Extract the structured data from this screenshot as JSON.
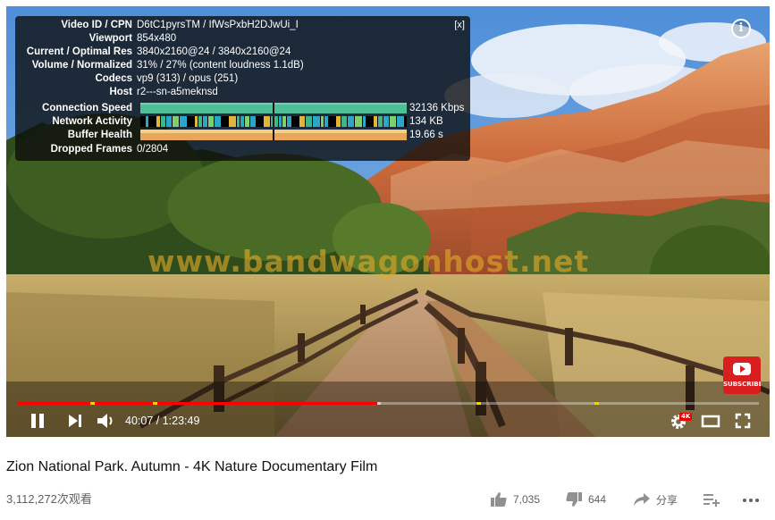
{
  "stats_overlay": {
    "close": "[x]",
    "rows": [
      {
        "label": "Video ID / CPN",
        "value": "D6tC1pyrsTM / IfWsPxbH2DJwUi_I"
      },
      {
        "label": "Viewport",
        "value": "854x480"
      },
      {
        "label": "Current / Optimal Res",
        "value": "3840x2160@24 / 3840x2160@24"
      },
      {
        "label": "Volume / Normalized",
        "value": "31% / 27% (content loudness 1.1dB)"
      },
      {
        "label": "Codecs",
        "value": "vp9 (313) / opus (251)"
      },
      {
        "label": "Host",
        "value": "r2---sn-a5meknsd"
      }
    ],
    "graphs": [
      {
        "label": "Connection Speed",
        "value": "32136 Kbps"
      },
      {
        "label": "Network Activity",
        "value": "134 KB"
      },
      {
        "label": "Buffer Health",
        "value": "19.66 s"
      }
    ],
    "dropped": {
      "label": "Dropped Frames",
      "value": "0/2804"
    }
  },
  "watermark": "www.bandwagonhost.net",
  "info_button": "i",
  "subscribe_badge": {
    "label": "SUBSCRIBE"
  },
  "player": {
    "time": "40:07 / 1:23:49",
    "progress_played": 0.486,
    "progress_buffered": 0.49,
    "quality_badge": "4K"
  },
  "video": {
    "title": "Zion National Park. Autumn - 4K Nature Documentary Film",
    "views": "3,112,272次观看"
  },
  "actions": {
    "like_count": "7,035",
    "dislike_count": "644",
    "share_label": "分享"
  },
  "colors": {
    "progress_red": "#ff0000",
    "chapter_yellow": "#f5d400",
    "subscribe_red": "#d81e1e"
  }
}
